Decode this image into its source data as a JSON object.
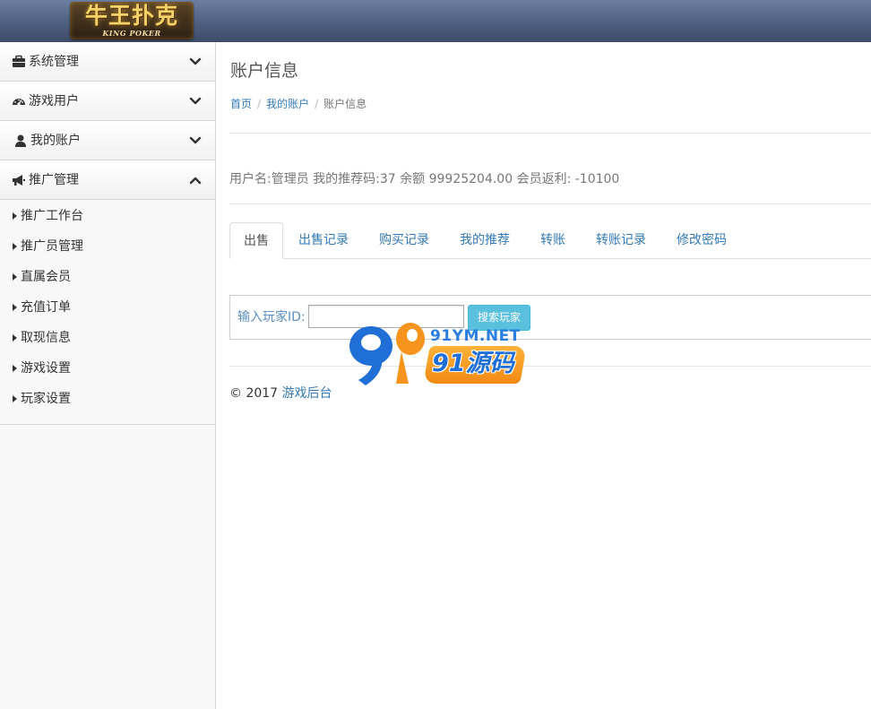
{
  "header": {
    "logo_main": "牛王扑克",
    "logo_sub": "KING POKER"
  },
  "sidebar": {
    "groups": [
      {
        "label": "系统管理",
        "icon": "briefcase-icon",
        "expanded": false
      },
      {
        "label": "游戏用户",
        "icon": "dashboard-icon",
        "expanded": false
      },
      {
        "label": "我的账户",
        "icon": "user-icon",
        "expanded": false
      },
      {
        "label": "推广管理",
        "icon": "bullhorn-icon",
        "expanded": true
      }
    ],
    "sub_items": [
      "推广工作台",
      "推广员管理",
      "直属会员",
      "充值订单",
      "取现信息",
      "游戏设置",
      "玩家设置"
    ]
  },
  "page": {
    "title": "账户信息",
    "breadcrumb": [
      "首页",
      "我的账户",
      "账户信息"
    ],
    "account_info": "用户名:管理员 我的推荐码:37 余额 99925204.00 会员返利: -10100"
  },
  "tabs": [
    {
      "label": "出售",
      "active": true
    },
    {
      "label": "出售记录",
      "active": false
    },
    {
      "label": "购买记录",
      "active": false
    },
    {
      "label": "我的推荐",
      "active": false
    },
    {
      "label": "转账",
      "active": false
    },
    {
      "label": "转账记录",
      "active": false
    },
    {
      "label": "修改密码",
      "active": false
    }
  ],
  "search": {
    "label": "输入玩家ID:",
    "value": "",
    "button": "搜索玩家"
  },
  "footer": {
    "copyright": "© 2017",
    "link": "游戏后台"
  },
  "watermark": {
    "url": "91YM.NET",
    "brand": "91源码"
  },
  "colors": {
    "link": "#337ab7",
    "info_button": "#5bc0de",
    "topbar": "#4f5f80"
  }
}
